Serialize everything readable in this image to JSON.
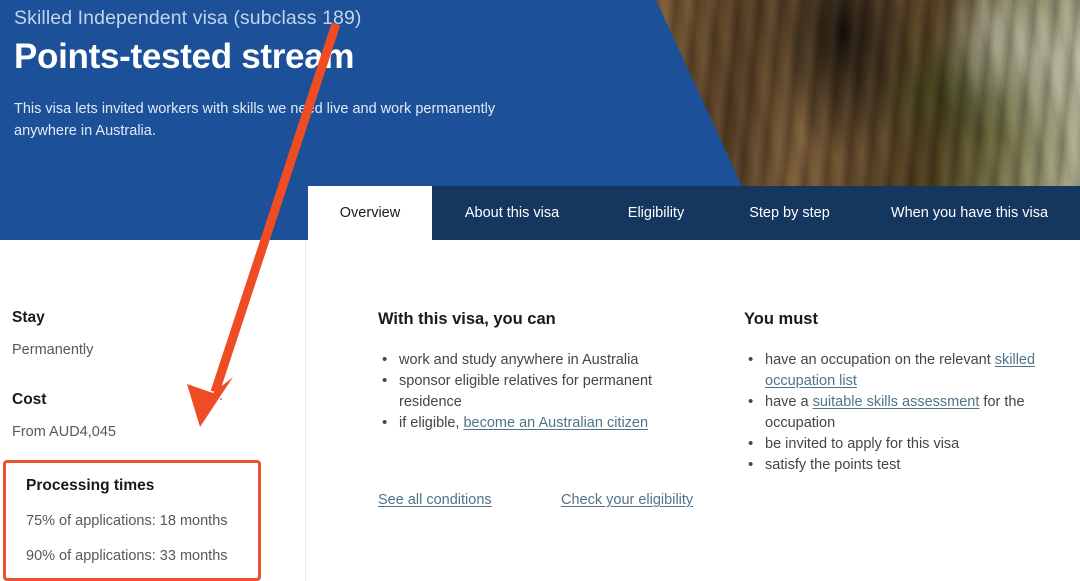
{
  "hero": {
    "eyebrow": "Skilled Independent visa (subclass 189)",
    "title": "Points-tested stream",
    "description": "This visa lets invited workers with skills we need live and work permanently anywhere in Australia.",
    "background_image": "tree-trunk-photo",
    "overlay_color": "#1c5199"
  },
  "tabs": [
    {
      "label": "Overview",
      "active": true
    },
    {
      "label": "About this visa",
      "active": false
    },
    {
      "label": "Eligibility",
      "active": false
    },
    {
      "label": "Step by step",
      "active": false
    },
    {
      "label": "When you have this visa",
      "active": false
    }
  ],
  "left_column": {
    "stay": {
      "label": "Stay",
      "value": "Permanently"
    },
    "cost": {
      "label": "Cost",
      "value": "From AUD4,045"
    },
    "processing_times": {
      "title": "Processing times",
      "rows": [
        "75% of applications: 18 months",
        "90% of applications: 33 months"
      ]
    }
  },
  "middle_column": {
    "heading": "With this visa, you can",
    "items": [
      {
        "pre": "work and study anywhere in Australia",
        "link": "",
        "post": ""
      },
      {
        "pre": "sponsor eligible relatives for permanent residence",
        "link": "",
        "post": ""
      },
      {
        "pre": "if eligible, ",
        "link": "become an Australian citizen",
        "post": ""
      }
    ],
    "actions": [
      "See all conditions",
      "Check your eligibility"
    ]
  },
  "right_column": {
    "heading": "You must",
    "items": [
      {
        "pre": "have an occupation on the relevant ",
        "link": "skilled occupation list",
        "post": ""
      },
      {
        "pre": "have a ",
        "link": "suitable skills assessment",
        "post": " for the occupation"
      },
      {
        "pre": "be invited to apply for this visa",
        "link": "",
        "post": ""
      },
      {
        "pre": "satisfy the points test",
        "link": "",
        "post": ""
      }
    ]
  },
  "annotation": {
    "arrow_color": "#ef4c23",
    "highlight_box_color": "#e8552c",
    "arrow_from": "335,24",
    "arrow_to": "200,427",
    "target": "processing-times-box"
  }
}
